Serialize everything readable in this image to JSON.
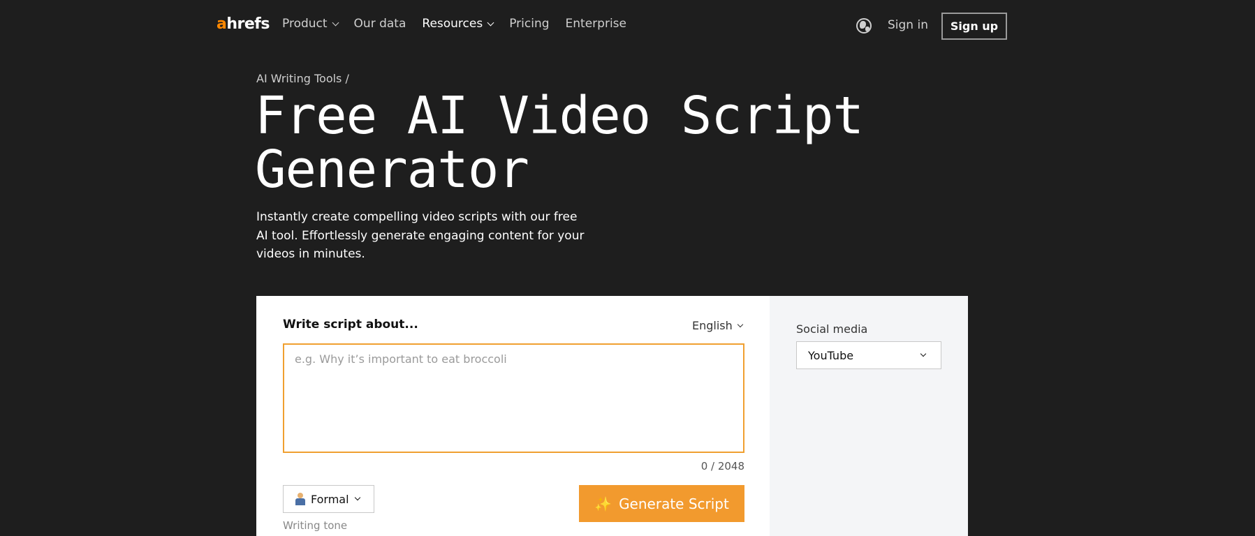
{
  "nav": {
    "logo_a": "a",
    "logo_rest": "hrefs",
    "links": [
      {
        "label": "Product",
        "dropdown": true
      },
      {
        "label": "Our data",
        "dropdown": false
      },
      {
        "label": "Resources",
        "dropdown": true
      },
      {
        "label": "Pricing",
        "dropdown": false
      },
      {
        "label": "Enterprise",
        "dropdown": false
      }
    ],
    "signin": "Sign in",
    "signup": "Sign up"
  },
  "hero": {
    "breadcrumb": "AI Writing Tools /",
    "title_line1": "Free AI Video Script",
    "title_line2": "Generator",
    "subtitle": "Instantly create compelling video scripts with our free AI tool. Effortlessly generate engaging content for your videos in minutes."
  },
  "tool": {
    "write_label": "Write script about...",
    "language": "English",
    "placeholder": "e.g. Why it’s important to eat broccoli",
    "counter": "0 / 2048",
    "tone": "Formal",
    "tone_caption": "Writing tone",
    "generate": "Generate Script",
    "social_label": "Social media",
    "social_value": "YouTube"
  },
  "colors": {
    "background": "#1e1e1e",
    "accent": "#f29a2e",
    "logo_accent": "#ff8800",
    "side_panel": "#f4f5f7"
  },
  "icons": [
    "globe-icon",
    "chevron-down-icon",
    "sparkle-icon",
    "businessperson-emoji-icon"
  ]
}
